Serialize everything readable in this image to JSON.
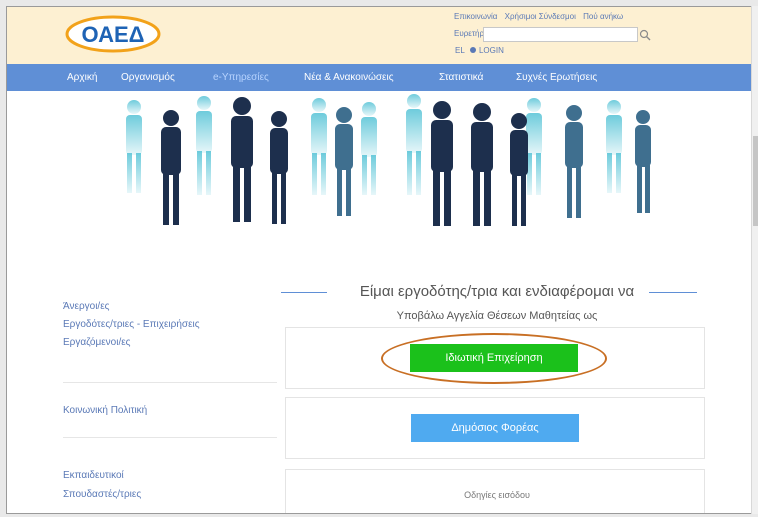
{
  "header": {
    "top_links": [
      "Επικοινωνία",
      "Χρήσιμοι Σύνδεσμοι",
      "Πού ανήκω"
    ],
    "search_label": "Ευρετήρ",
    "search_placeholder": "",
    "lang": "EL",
    "login": "LOGIN"
  },
  "logo": {
    "text": "ΟΑΕΔ",
    "colors": {
      "bg": "#ffffff",
      "text": "#1e63b5",
      "ring": "#f2a21a"
    }
  },
  "nav": {
    "items": [
      {
        "label": "Αρχική"
      },
      {
        "label": "Οργανισμός"
      },
      {
        "label": "e-Υπηρεσίες"
      },
      {
        "label": "Νέα & Ανακοινώσεις"
      },
      {
        "label": "Στατιστικά"
      },
      {
        "label": "Συχνές Ερωτήσεις"
      }
    ],
    "colors": {
      "bg": "#5f8fd6",
      "active_text": "#b8d4ff"
    }
  },
  "sidebar": {
    "groups": [
      [
        "Άνεργοι/ες",
        "Εργοδότες/τριες - Επιχειρήσεις",
        "Εργαζόμενοι/ες"
      ],
      [
        "Κοινωνική Πολιτική"
      ],
      [
        "Εκπαιδευτικοί",
        "Σπουδαστές/τριες"
      ]
    ]
  },
  "main": {
    "heading": "Είμαι εργοδότης/τρια και ενδιαφέρομαι να",
    "subheading": "Υποβάλω Αγγελία Θέσεων Μαθητείας ως",
    "private_button": "Ιδιωτική Επιχείρηση",
    "public_button": "Δημόσιος Φορέας",
    "help_link": "Οδηγίες εισόδου",
    "colors": {
      "private": "#1bc11b",
      "public": "#4faaf0",
      "highlight": "#c86f24"
    }
  }
}
